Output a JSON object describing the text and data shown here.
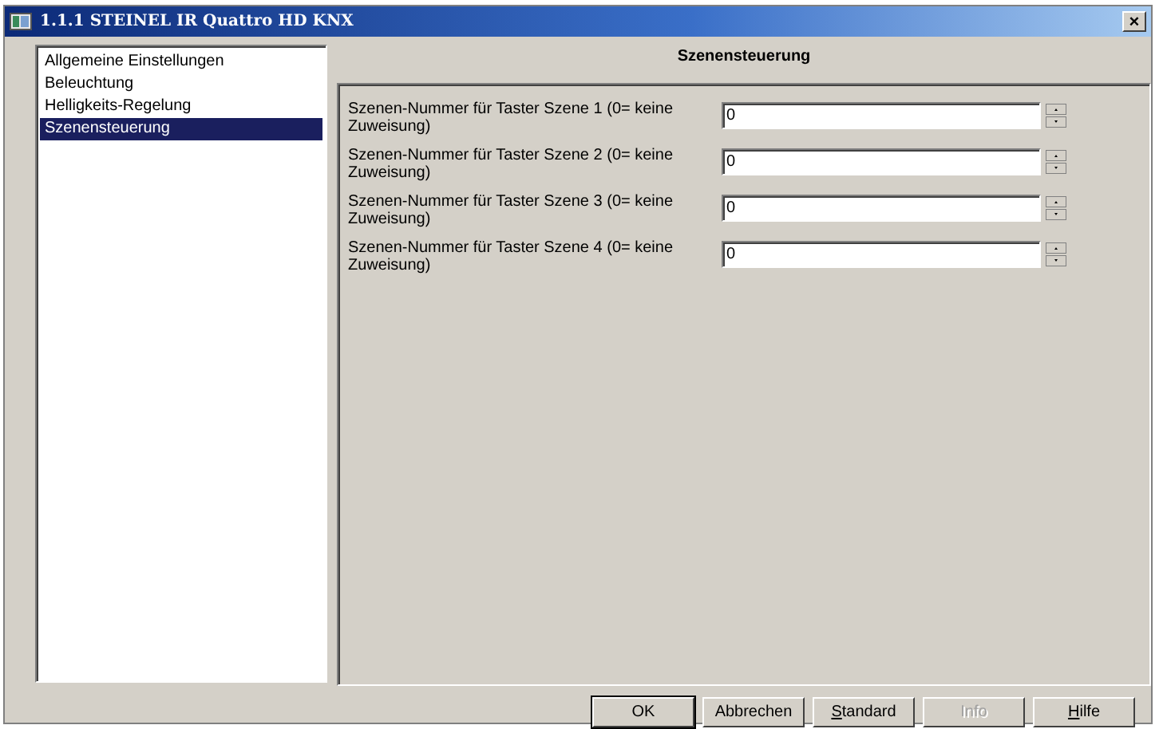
{
  "window": {
    "title": "1.1.1 STEINEL IR Quattro HD KNX",
    "close": "×"
  },
  "sidebar": {
    "items": [
      {
        "label": "Allgemeine Einstellungen",
        "selected": false
      },
      {
        "label": "Beleuchtung",
        "selected": false
      },
      {
        "label": "Helligkeits-Regelung",
        "selected": false
      },
      {
        "label": "Szenensteuerung",
        "selected": true
      }
    ]
  },
  "panel": {
    "title": "Szenensteuerung",
    "rows": [
      {
        "label": "Szenen-Nummer für Taster Szene 1 (0= keine Zuweisung)",
        "value": "0"
      },
      {
        "label": "Szenen-Nummer für Taster Szene 2 (0= keine Zuweisung)",
        "value": "0"
      },
      {
        "label": "Szenen-Nummer für Taster Szene 3 (0= keine Zuweisung)",
        "value": "0"
      },
      {
        "label": "Szenen-Nummer für Taster Szene 4 (0= keine Zuweisung)",
        "value": "0"
      }
    ]
  },
  "buttons": [
    {
      "label": "OK",
      "default": true,
      "disabled": false,
      "mnemonic": false
    },
    {
      "label": "Abbrechen",
      "default": false,
      "disabled": false,
      "mnemonic": false
    },
    {
      "label": "Standard",
      "default": false,
      "disabled": false,
      "mnemonic": true
    },
    {
      "label": "Info",
      "default": false,
      "disabled": true,
      "mnemonic": false
    },
    {
      "label": "Hilfe",
      "default": false,
      "disabled": false,
      "mnemonic": true
    }
  ]
}
